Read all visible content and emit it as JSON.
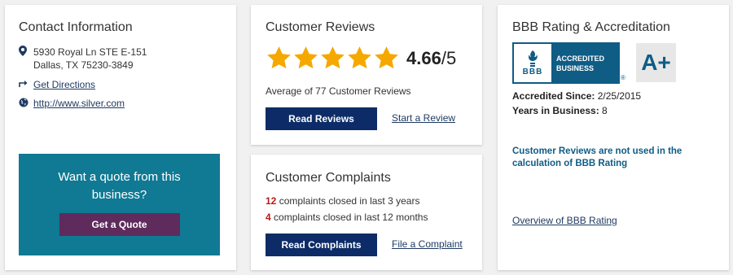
{
  "contact": {
    "title": "Contact Information",
    "address_line1": "5930 Royal Ln STE E-151",
    "address_line2": "Dallas, TX 75230-3849",
    "directions_label": "Get Directions",
    "website": "http://www.silver.com",
    "quote": {
      "text": "Want a quote from this business?",
      "button_label": "Get a Quote",
      "bg_color": "#107993",
      "button_color": "#5e2b5c"
    }
  },
  "reviews": {
    "title": "Customer Reviews",
    "rating": "4.66",
    "rating_max": "/5",
    "stars_filled": 5,
    "average_text": "Average of 77 Customer Reviews",
    "read_button": "Read Reviews",
    "start_link": "Start a Review"
  },
  "complaints": {
    "title": "Customer Complaints",
    "line1_count": "12",
    "line1_text": " complaints closed in last 3 years",
    "line2_count": "4",
    "line2_text": " complaints closed in last 12 months",
    "read_button": "Read Complaints",
    "file_link": "File a Complaint"
  },
  "bbb": {
    "title": "BBB Rating & Accreditation",
    "badge_logo": "BBB",
    "badge_line1": "ACCREDITED",
    "badge_line2": "BUSINESS",
    "registered": "®",
    "grade": "A+",
    "accredited_label": "Accredited Since:",
    "accredited_value": " 2/25/2015",
    "years_label": "Years in Business:",
    "years_value": " 8",
    "note": "Customer Reviews are not used in the calculation of BBB Rating",
    "overview_link": "Overview of BBB Rating"
  },
  "colors": {
    "navy": "#0d2c67",
    "bbb_blue": "#0f5c85",
    "star": "#f5a800",
    "complaint_count": "#b51c1c"
  }
}
